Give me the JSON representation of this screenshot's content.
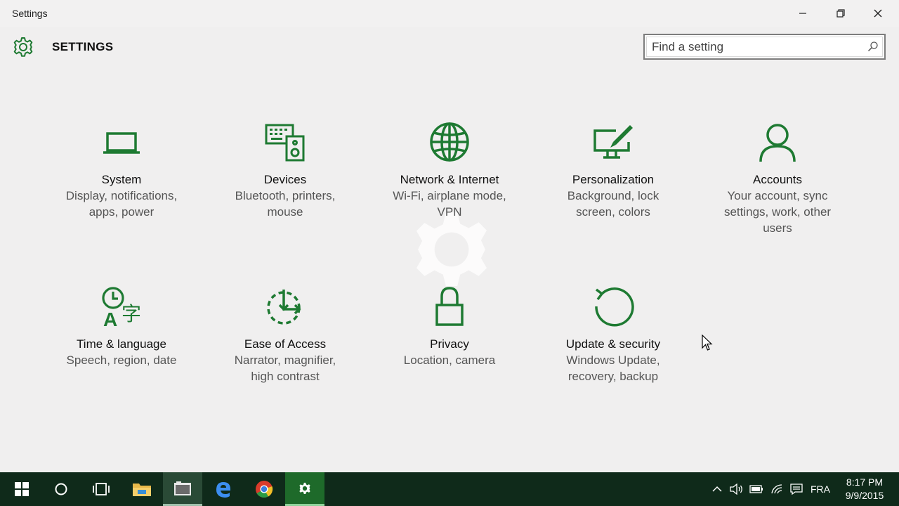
{
  "window": {
    "title": "Settings",
    "minimize_icon": "minimize-icon",
    "restore_icon": "restore-icon",
    "close_icon": "close-icon"
  },
  "header": {
    "title": "SETTINGS",
    "icon": "gear-icon"
  },
  "search": {
    "placeholder": "Find a setting",
    "value": "",
    "icon": "search-icon"
  },
  "accent_color": "#1e7a32",
  "tiles": [
    {
      "name": "System",
      "description": "Display, notifications, apps, power",
      "icon": "laptop-icon"
    },
    {
      "name": "Devices",
      "description": "Bluetooth, printers, mouse",
      "icon": "keyboard-speaker-icon"
    },
    {
      "name": "Network & Internet",
      "description": "Wi-Fi, airplane mode, VPN",
      "icon": "globe-icon"
    },
    {
      "name": "Personalization",
      "description": "Background, lock screen, colors",
      "icon": "paintbrush-monitor-icon"
    },
    {
      "name": "Accounts",
      "description": "Your account, sync settings, work, other users",
      "icon": "person-icon"
    },
    {
      "name": "Time & language",
      "description": "Speech, region, date",
      "icon": "clock-language-icon"
    },
    {
      "name": "Ease of Access",
      "description": "Narrator, magnifier, high contrast",
      "icon": "ease-of-access-icon"
    },
    {
      "name": "Privacy",
      "description": "Location, camera",
      "icon": "padlock-icon"
    },
    {
      "name": "Update & security",
      "description": "Windows Update, recovery, backup",
      "icon": "refresh-icon"
    }
  ],
  "taskbar": {
    "items": [
      "start-icon",
      "search-circle-icon",
      "task-view-icon",
      "file-explorer-icon",
      "app-icon",
      "edge-icon",
      "chrome-icon",
      "settings-gear-icon"
    ],
    "tray": {
      "language": "FRA",
      "time": "8:17 PM",
      "date": "9/9/2015"
    }
  }
}
